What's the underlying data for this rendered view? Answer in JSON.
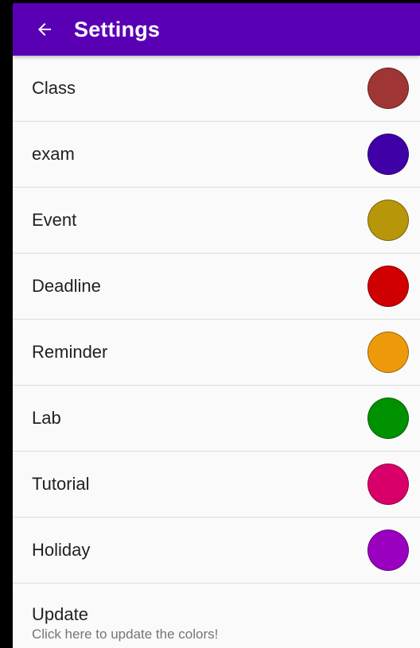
{
  "app_bar": {
    "title": "Settings",
    "back_icon": "arrow-left-icon",
    "color": "#5a00b4"
  },
  "categories": [
    {
      "label": "Class",
      "color": "#a03535"
    },
    {
      "label": "exam",
      "color": "#3f00a8"
    },
    {
      "label": "Event",
      "color": "#b8960a"
    },
    {
      "label": "Deadline",
      "color": "#d00000"
    },
    {
      "label": "Reminder",
      "color": "#ed9a0a"
    },
    {
      "label": "Lab",
      "color": "#009100"
    },
    {
      "label": "Tutorial",
      "color": "#d80068"
    },
    {
      "label": "Holiday",
      "color": "#9a00c0"
    }
  ],
  "update": {
    "title": "Update",
    "subtitle": "Click here to update the colors!"
  }
}
